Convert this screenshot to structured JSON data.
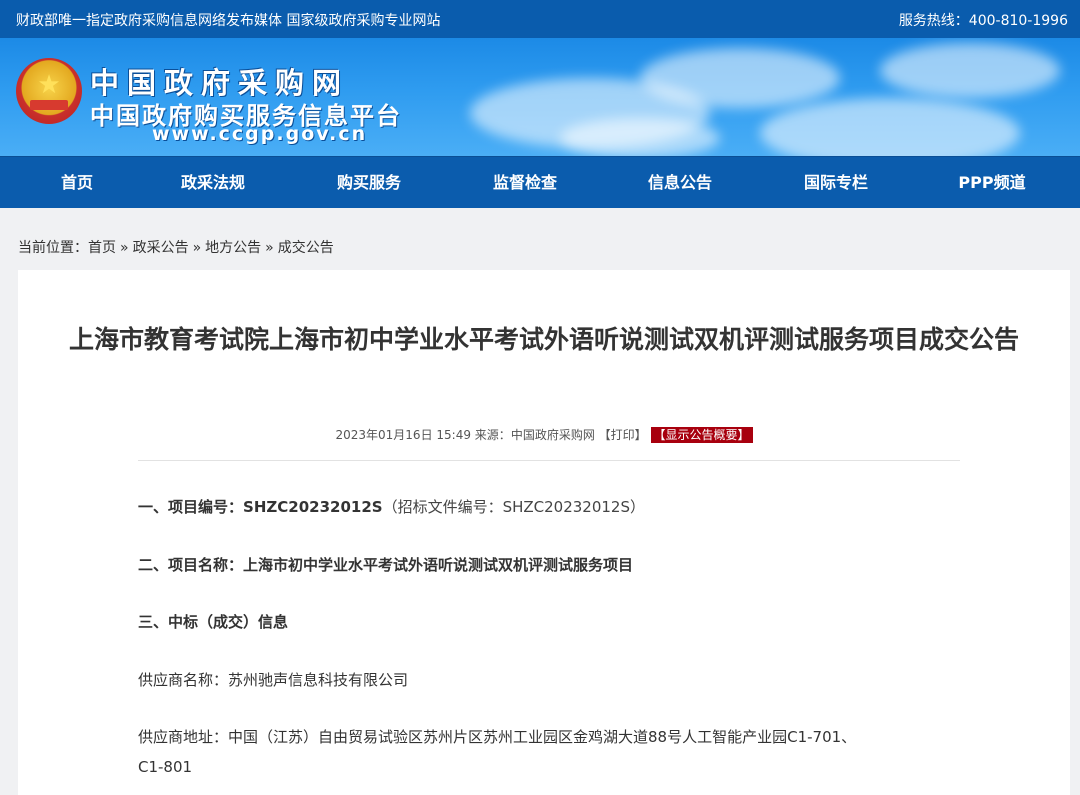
{
  "topbar": {
    "left_text": "财政部唯一指定政府采购信息网络发布媒体 国家级政府采购专业网站",
    "hotline": "服务热线：400-810-1996"
  },
  "logo": {
    "title": "中国政府采购网",
    "subtitle": "中国政府购买服务信息平台",
    "url": "www.ccgp.gov.cn"
  },
  "nav": {
    "items": [
      "首页",
      "政采法规",
      "购买服务",
      "监督检查",
      "信息公告",
      "国际专栏",
      "PPP频道"
    ]
  },
  "breadcrumb": {
    "prefix": "当前位置：",
    "items": [
      "首页",
      "政采公告",
      "地方公告",
      "成交公告"
    ],
    "separator": "»"
  },
  "article": {
    "title": "上海市教育考试院上海市初中学业水平考试外语听说测试双机评测试服务项目成交公告",
    "meta": {
      "datetime": "2023年01月16日 15:49",
      "source_label": "来源：",
      "source": "中国政府采购网",
      "print": "【打印】",
      "summary_button": "【显示公告概要】"
    },
    "sections": {
      "s1_label": "一、项目编号：",
      "s1_value": "SHZC20232012S",
      "s1_note": "（招标文件编号：SHZC20232012S）",
      "s2_label": "二、项目名称：",
      "s2_value": "上海市初中学业水平考试外语听说测试双机评测试服务项目",
      "s3_label": "三、中标（成交）信息",
      "supplier_name_label": "供应商名称：",
      "supplier_name": "苏州驰声信息科技有限公司",
      "supplier_addr_label": "供应商地址：",
      "supplier_addr_line1": "中国（江苏）自由贸易试验区苏州片区苏州工业园区金鸡湖大道88号人工智能产业园C1-701、",
      "supplier_addr_line2": "C1-801"
    }
  }
}
